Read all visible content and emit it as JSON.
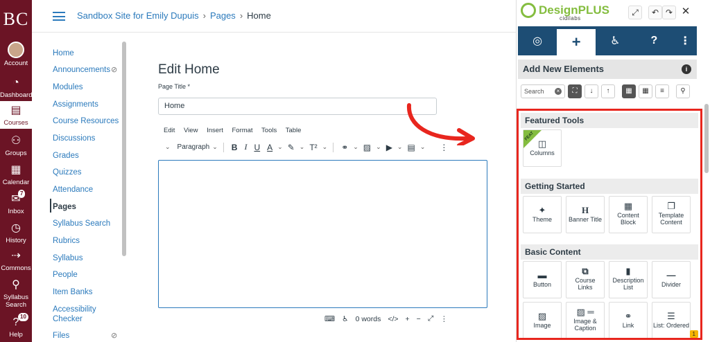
{
  "global_nav": {
    "logo": "BC",
    "items": [
      {
        "label": "Account",
        "icon": "avatar"
      },
      {
        "label": "Dashboard",
        "icon": "speedometer-icon"
      },
      {
        "label": "Courses",
        "icon": "book-icon",
        "active": true
      },
      {
        "label": "Groups",
        "icon": "people-icon"
      },
      {
        "label": "Calendar",
        "icon": "calendar-icon"
      },
      {
        "label": "Inbox",
        "icon": "inbox-icon",
        "badge": "7"
      },
      {
        "label": "History",
        "icon": "clock-icon"
      },
      {
        "label": "Commons",
        "icon": "commons-icon"
      },
      {
        "label": "Syllabus Search",
        "line1": "Syllabus",
        "line2": "Search",
        "icon": "search-icon"
      },
      {
        "label": "Help",
        "icon": "help-icon",
        "badge": "10"
      }
    ]
  },
  "breadcrumb": {
    "site": "Sandbox Site for Emily Dupuis",
    "section": "Pages",
    "current": "Home"
  },
  "course_nav": {
    "items": [
      "Home",
      "Announcements",
      "Modules",
      "Assignments",
      "Course Resources",
      "Discussions",
      "Grades",
      "Quizzes",
      "Attendance",
      "Pages",
      "Syllabus Search",
      "Rubrics",
      "Syllabus",
      "People",
      "Item Banks",
      "Accessibility Checker",
      "Files"
    ],
    "active": "Pages"
  },
  "editor": {
    "heading": "Edit Home",
    "title_label": "Page Title",
    "required_mark": "*",
    "title_value": "Home",
    "menu": [
      "Edit",
      "View",
      "Insert",
      "Format",
      "Tools",
      "Table"
    ],
    "block_format": "Paragraph",
    "word_count": "0 words"
  },
  "designplus": {
    "brand": "DesignPLUS",
    "sub": "cidilabs",
    "panel_title": "Add New Elements",
    "search_placeholder": "Search",
    "sections": [
      {
        "title": "Featured Tools",
        "tiles": [
          {
            "label": "Columns",
            "icon": "columns-icon",
            "badge": "FEAT"
          }
        ]
      },
      {
        "title": "Getting Started",
        "tiles": [
          {
            "label": "Theme",
            "icon": "magic-wand-icon"
          },
          {
            "label": "Banner Title",
            "icon": "heading-icon"
          },
          {
            "label": "Content Block",
            "icon": "grid-icon"
          },
          {
            "label": "Template Content",
            "icon": "copy-icon"
          }
        ]
      },
      {
        "title": "Basic Content",
        "tiles": [
          {
            "label": "Button",
            "icon": "button-icon"
          },
          {
            "label": "Course Links",
            "icon": "course-links-icon"
          },
          {
            "label": "Description List",
            "icon": "book-icon"
          },
          {
            "label": "Divider",
            "icon": "divider-icon"
          },
          {
            "label": "Image",
            "icon": "image-icon"
          },
          {
            "label": "Image & Caption",
            "icon": "image-caption-icon"
          },
          {
            "label": "Link",
            "icon": "link-icon"
          },
          {
            "label": "List: Ordered",
            "icon": "ordered-list-icon"
          }
        ]
      }
    ],
    "corner_badge": "1"
  },
  "colors": {
    "canvas_nav": "#6b1425",
    "link": "#2b7abc",
    "dp_navy": "#1d4d74",
    "dp_green": "#84bd3f",
    "highlight_red": "#e8261e"
  }
}
